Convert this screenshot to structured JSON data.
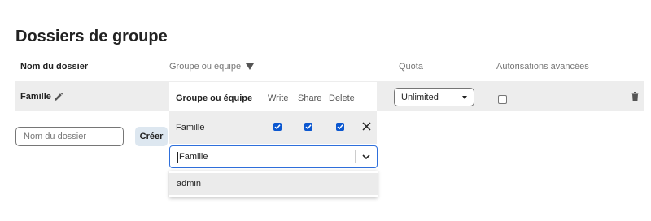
{
  "page": {
    "title": "Dossiers de groupe"
  },
  "table": {
    "headers": {
      "name": "Nom du dossier",
      "group": "Groupe ou équipe",
      "quota": "Quota",
      "advanced": "Autorisations avancées"
    },
    "rows": [
      {
        "name": "Famille",
        "quota": "Unlimited",
        "advanced_permissions": false
      }
    ]
  },
  "group_panel": {
    "headers": {
      "group": "Groupe ou équipe",
      "write": "Write",
      "share": "Share",
      "delete": "Delete"
    },
    "groups": [
      {
        "name": "Famille",
        "write": true,
        "share": true,
        "delete": true
      }
    ],
    "select": {
      "value": "Famille",
      "options": [
        "admin"
      ]
    }
  },
  "new_folder": {
    "placeholder": "Nom du dossier",
    "create_label": "Créer"
  },
  "colors": {
    "accent": "#0b57d0",
    "focus_border": "#2e6fdb",
    "row_bg": "#ededed",
    "create_button_bg": "#dde7f0"
  },
  "icons": [
    "sort-desc-icon",
    "pencil-icon",
    "chevron-down-icon",
    "trash-icon",
    "close-icon",
    "check-icon"
  ]
}
